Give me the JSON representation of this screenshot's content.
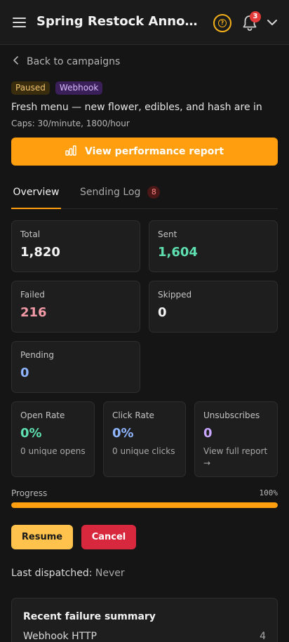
{
  "header": {
    "title": "Spring Restock Announcement",
    "notification_count": "3",
    "icons": [
      "menu-icon",
      "help-icon",
      "bell-icon",
      "chevron-down-icon"
    ]
  },
  "back_link": {
    "label": "Back to campaigns"
  },
  "badges": {
    "status": "Paused",
    "channel": "Webhook"
  },
  "campaign": {
    "message": "Fresh menu — new flower, edibles, and hash are in",
    "caps": "Caps: 30/minute, 1800/hour"
  },
  "report_button": {
    "label": "View performance report",
    "icon": "bar-chart-icon"
  },
  "tabs": {
    "overview": "Overview",
    "sending_log": "Sending Log",
    "sending_log_count": "8"
  },
  "stats": {
    "total": {
      "label": "Total",
      "value": "1,820"
    },
    "sent": {
      "label": "Sent",
      "value": "1,604"
    },
    "failed": {
      "label": "Failed",
      "value": "216"
    },
    "skipped": {
      "label": "Skipped",
      "value": "0"
    },
    "pending": {
      "label": "Pending",
      "value": "0"
    }
  },
  "engagement": {
    "open_rate": {
      "label": "Open Rate",
      "value": "0%",
      "sub": "0 unique opens"
    },
    "click_rate": {
      "label": "Click Rate",
      "value": "0%",
      "sub": "0 unique clicks"
    },
    "unsubscribes": {
      "label": "Unsubscribes",
      "value": "0",
      "sub": "View full report →"
    }
  },
  "progress": {
    "label": "Progress",
    "value_text": "100%",
    "fraction": 1.0
  },
  "actions": {
    "resume": "Resume",
    "cancel": "Cancel"
  },
  "last_dispatched": {
    "label": "Last dispatched:",
    "value": "Never"
  },
  "failure_summary": {
    "title": "Recent failure summary",
    "rows": [
      {
        "reason": "Webhook HTTP",
        "count": "4"
      }
    ]
  },
  "colors": {
    "accent": "#ff9f0f",
    "sent": "#5fe0b0",
    "failed": "#f39aa7",
    "pending": "#8fb5ff",
    "open_rate": "#5fe0b0",
    "click_rate": "#8fb5ff",
    "unsubscribes": "#c9a6ff",
    "danger": "#d8283d"
  }
}
